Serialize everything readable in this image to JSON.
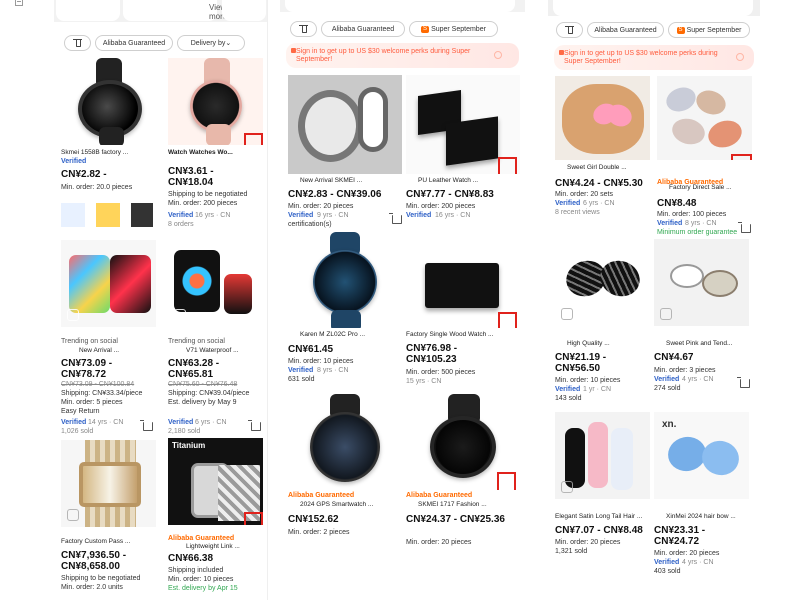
{
  "screens": [
    {
      "top_card_label": "View more",
      "filters": {
        "guaranteed": "Alibaba Guaranteed",
        "delivery": "Delivery by"
      },
      "products": [
        {
          "title": "Skmei 1558B factory ...",
          "price": "CN¥2.82 -",
          "detail": [
            "Min. order: 20.0 pieces"
          ],
          "supplier": "Verified"
        },
        {
          "title": "Watch Watches Wo...",
          "price": "CN¥3.61 - CN¥18.04",
          "detail": [
            "Shipping to be negotiated",
            "Min. order: 200 pieces"
          ],
          "supplier": "Verified",
          "meta": "16 yrs · CN",
          "sold": "8 orders"
        },
        {
          "title": "Trending on social",
          "title2": "New Arrival ...",
          "price": "CN¥73.09 - CN¥78.72",
          "strike": "CN¥73.09 - CN¥100.84",
          "detail": [
            "Shipping: CN¥33.34/piece",
            "Min. order: 5 pieces",
            "Easy Return"
          ],
          "supplier": "Verified",
          "meta": "14 yrs · CN",
          "sold": "1,026 sold"
        },
        {
          "title": "Trending on social",
          "title2": "V71 Waterproof ...",
          "price": "CN¥63.28 - CN¥65.81",
          "strike": "CN¥75.60 - CN¥76.48",
          "detail": [
            "Shipping: CN¥39.04/piece",
            "Est. delivery by May 9"
          ],
          "supplier": "Verified",
          "meta": "6 yrs · CN",
          "sold": "2,180 sold"
        },
        {
          "title": "Factory Custom Pass ...",
          "price": "CN¥7,936.50 - CN¥8,658.00",
          "detail": [
            "Shipping to be negotiated",
            "Min. order: 2.0 units"
          ]
        },
        {
          "title": "Titanium",
          "title2": "Lightweight Link ...",
          "price": "CN¥66.38",
          "detail": [
            "Shipping included",
            "Min. order: 10 pieces",
            "Est. delivery by Apr 15"
          ],
          "badge": "Alibaba Guaranteed"
        }
      ]
    },
    {
      "filters": {
        "guaranteed": "Alibaba Guaranteed",
        "super": "Super September"
      },
      "promo": "Sign in to get up to US $30 welcome perks during Super September!",
      "products": [
        {
          "title": "New Arrival SKMEI ...",
          "price": "CN¥2.83 - CN¥39.06",
          "detail": [
            "Min. order: 20 pieces"
          ],
          "supplier": "Verified",
          "meta": "9 yrs · CN",
          "sold": "certification(s)"
        },
        {
          "title": "PU Leather Watch ...",
          "price": "CN¥7.77 - CN¥8.83",
          "detail": [
            "Min. order: 200 pieces"
          ],
          "supplier": "Verified",
          "meta": "16 yrs · CN"
        },
        {
          "title": "Karen M ZL02C Pro ...",
          "price": "CN¥61.45",
          "detail": [
            "Min. order: 10 pieces"
          ],
          "supplier": "Verified",
          "meta": "8 yrs · CN",
          "sold": "631 sold"
        },
        {
          "title": "Factory Single Wood Watch ...",
          "price": "CN¥76.98 - CN¥105.23",
          "detail": [
            "Min. order: 500 pieces"
          ],
          "supplier": "15 yrs · CN"
        },
        {
          "title": "2024 GPS Smartwatch ...",
          "price": "CN¥152.62",
          "detail": [
            "Min. order: 2 pieces"
          ],
          "badge": "Alibaba Guaranteed"
        },
        {
          "title": "SKMEI 1717 Fashion ...",
          "price": "CN¥24.37 - CN¥25.36",
          "detail": [
            "Min. order: 20 pieces"
          ],
          "badge": "Alibaba Guaranteed"
        }
      ]
    },
    {
      "filters": {
        "guaranteed": "Alibaba Guaranteed",
        "super": "Super September"
      },
      "promo": "Sign in to get up to US $30 welcome perks during Super September!",
      "products": [
        {
          "title": "Sweet Girl Double ...",
          "price": "CN¥4.24 - CN¥5.30",
          "detail": [
            "Min. order: 20 sets"
          ],
          "supplier": "Verified",
          "meta": "6 yrs · CN",
          "sold": "8 recent views"
        },
        {
          "title": "Factory Direct Sale ...",
          "price": "CN¥8.48",
          "detail": [
            "Min. order: 100 pieces"
          ],
          "supplier": "Verified",
          "meta": "8 yrs · CN",
          "sold": "Minimum order guarantee",
          "badge": "Alibaba Guaranteed"
        },
        {
          "title": "High Quality ...",
          "price": "CN¥21.19 - CN¥56.50",
          "detail": [
            "Min. order: 10 pieces"
          ],
          "supplier": "Verified",
          "meta": "1 yr · CN",
          "sold": "143 sold"
        },
        {
          "title": "Sweet Pink and Tend...",
          "price": "CN¥4.67",
          "detail": [
            "Min. order: 3 pieces"
          ],
          "supplier": "Verified",
          "meta": "4 yrs · CN",
          "sold": "274 sold"
        },
        {
          "title": "Elegant Satin Long Tail Hair ...",
          "price": "CN¥7.07 - CN¥8.48",
          "detail": [
            "Min. order: 20 pieces"
          ],
          "sold": "1,321 sold"
        },
        {
          "title": "XinMei 2024 hair bow ...",
          "price": "CN¥23.31 - CN¥24.72",
          "detail": [
            "Min. order: 20 pieces"
          ],
          "supplier": "Verified",
          "meta": "4 yrs · CN",
          "sold": "403 sold"
        }
      ]
    }
  ]
}
